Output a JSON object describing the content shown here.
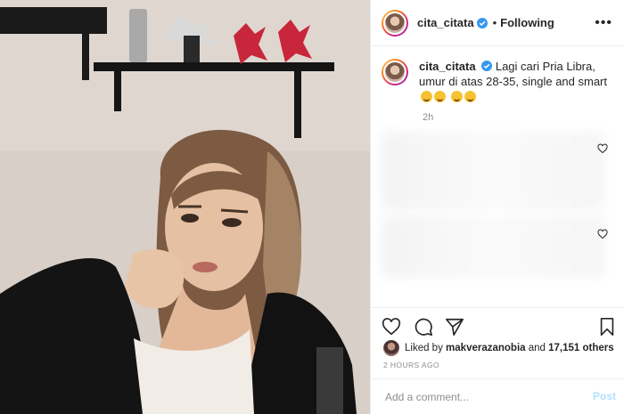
{
  "post": {
    "username": "cita_citata",
    "following_label": "Following",
    "more_label": "•••",
    "separator": "•",
    "caption_username": "cita_citata",
    "caption_text": "Lagi cari Pria Libra, umur di atas 28-35, single and smart",
    "relative_time": "2h",
    "liked_prefix": "Liked by",
    "liked_user": "makverazanobia",
    "liked_and": "and",
    "liked_count": "17,151 others",
    "timestamp": "2 HOURS AGO",
    "comment_placeholder": "Add a comment...",
    "post_label": "Post"
  },
  "icons": {
    "verified": "verified-badge-icon",
    "heart": "heart-icon",
    "comment": "comment-icon",
    "share": "share-icon",
    "save": "bookmark-icon"
  },
  "colors": {
    "accent_blue": "#3897f0",
    "post_button_disabled": "#b2dffc",
    "text": "#262626",
    "muted": "#8e8e8e"
  }
}
